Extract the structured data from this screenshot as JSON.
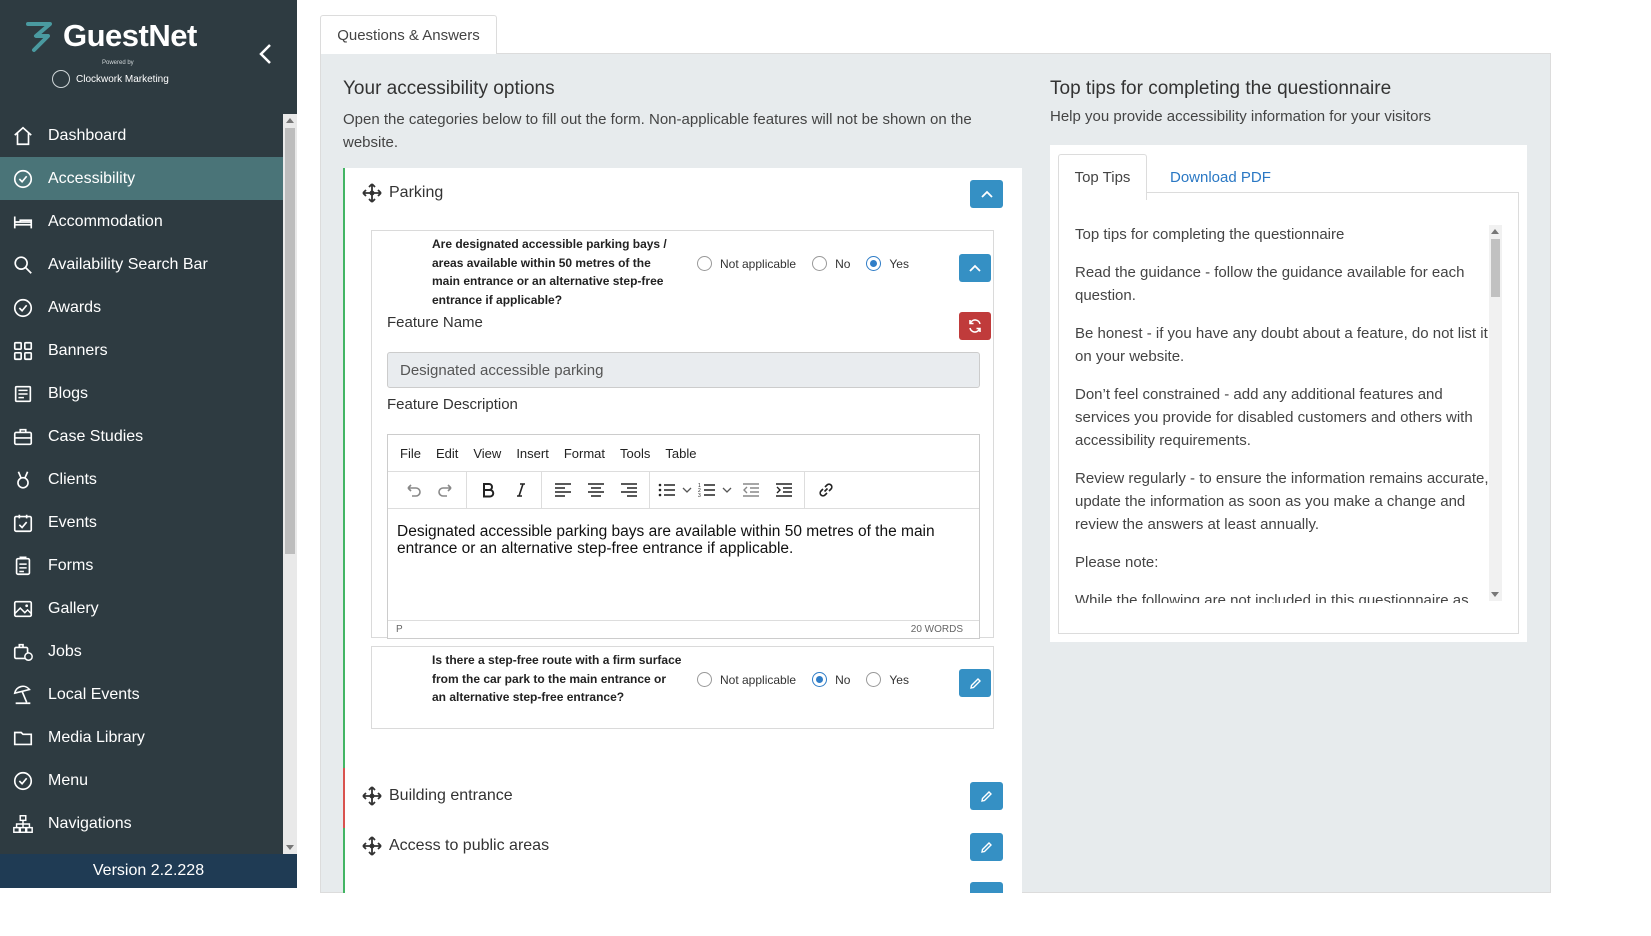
{
  "brand": {
    "name": "GuestNet",
    "powered_by": "Powered by",
    "company": "Clockwork Marketing"
  },
  "sidebar": {
    "items": [
      {
        "label": "Dashboard",
        "icon": "home-icon"
      },
      {
        "label": "Accessibility",
        "icon": "check-badge-icon",
        "active": true
      },
      {
        "label": "Accommodation",
        "icon": "bed-icon"
      },
      {
        "label": "Availability Search Bar",
        "icon": "search-icon"
      },
      {
        "label": "Awards",
        "icon": "award-icon"
      },
      {
        "label": "Banners",
        "icon": "grid-icon"
      },
      {
        "label": "Blogs",
        "icon": "newspaper-icon"
      },
      {
        "label": "Case Studies",
        "icon": "briefcase-icon"
      },
      {
        "label": "Clients",
        "icon": "medal-icon"
      },
      {
        "label": "Events",
        "icon": "calendar-check-icon"
      },
      {
        "label": "Forms",
        "icon": "clipboard-icon"
      },
      {
        "label": "Gallery",
        "icon": "image-icon"
      },
      {
        "label": "Jobs",
        "icon": "briefcase-clock-icon"
      },
      {
        "label": "Local Events",
        "icon": "beach-umbrella-icon"
      },
      {
        "label": "Media Library",
        "icon": "folder-icon"
      },
      {
        "label": "Menu",
        "icon": "check-badge-icon"
      },
      {
        "label": "Navigations",
        "icon": "sitemap-icon"
      }
    ],
    "version": "Version 2.2.228"
  },
  "main": {
    "tab_label": "Questions & Answers",
    "left_title": "Your accessibility options",
    "left_subtitle": "Open the categories below to fill out the form. Non-applicable features will not be shown on the website.",
    "right_title": "Top tips for completing the questionnaire",
    "right_subtitle": "Help you provide accessibility information for your visitors"
  },
  "categories": {
    "parking": "Parking",
    "building_entrance": "Building entrance",
    "public_areas": "Access to public areas"
  },
  "question1": {
    "text": "Are designated accessible parking bays / areas available within 50 metres of the main entrance or an alternative step-free entrance if applicable?",
    "opt_na": "Not applicable",
    "opt_no": "No",
    "opt_yes": "Yes",
    "selected": "Yes",
    "feature_name_label": "Feature Name",
    "feature_name_value": "Designated accessible parking",
    "feature_desc_label": "Feature Description",
    "description": "Designated accessible parking bays are available within 50 metres of the main entrance or an alternative step-free entrance if applicable.",
    "status_path": "P",
    "word_count": "20 WORDS"
  },
  "question2": {
    "text": "Is there a step-free route with a firm surface from the car park to the main entrance or an alternative step-free entrance?",
    "opt_na": "Not applicable",
    "opt_no": "No",
    "opt_yes": "Yes",
    "selected": "No"
  },
  "editor_menu": [
    "File",
    "Edit",
    "View",
    "Insert",
    "Format",
    "Tools",
    "Table"
  ],
  "tips": {
    "tab_top": "Top Tips",
    "tab_pdf": "Download PDF",
    "paragraphs": [
      "Top tips for completing the questionnaire",
      "Read the guidance - follow the guidance available for each question.",
      "Be honest - if you have any doubt about a feature, do not list it on your website.",
      "Don’t feel constrained - add any additional features and services you provide for disabled customers and others with accessibility requirements.",
      "Review regularly - to ensure the information remains accurate, update the information as soon as you make a change and review the answers at least annually.",
      "Please note:",
      "While the following are not included in this questionnaire as"
    ]
  },
  "colors": {
    "sidebar_bg": "#2e3b41",
    "sidebar_active": "#4a7478",
    "version_bg": "#1f3b54",
    "primary_button": "#3590c4",
    "danger_button": "#c03b3b",
    "link": "#2a78c4"
  }
}
